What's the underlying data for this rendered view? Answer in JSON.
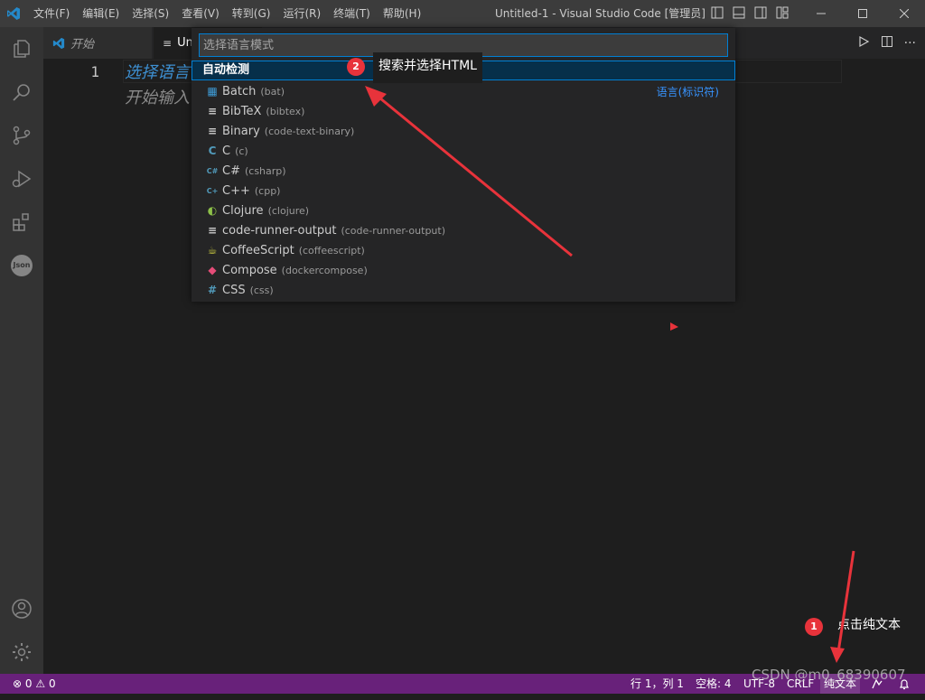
{
  "titlebar": {
    "menus": [
      "文件(F)",
      "编辑(E)",
      "选择(S)",
      "查看(V)",
      "转到(G)",
      "运行(R)",
      "终端(T)",
      "帮助(H)"
    ],
    "title": "Untitled-1 - Visual Studio Code [管理员]"
  },
  "tabs": {
    "start_label": "开始",
    "untitled_label": "Un"
  },
  "editor": {
    "line_number": "1",
    "ghost_line1": "选择语言",
    "ghost_line2": "开始输入"
  },
  "quickpick": {
    "placeholder": "选择语言模式",
    "active_item": "自动检测",
    "separator_label": "语言(标识符)",
    "items": [
      {
        "name": "Batch",
        "id": "(bat)",
        "icon": "windows-icon",
        "color": "#3e9bd6"
      },
      {
        "name": "BibTeX",
        "id": "(bibtex)",
        "icon": "lines-icon",
        "color": "#cccccc"
      },
      {
        "name": "Binary",
        "id": "(code-text-binary)",
        "icon": "lines-icon",
        "color": "#cccccc"
      },
      {
        "name": "C",
        "id": "(c)",
        "icon": "c-icon",
        "color": "#519aba"
      },
      {
        "name": "C#",
        "id": "(csharp)",
        "icon": "csharp-icon",
        "color": "#519aba"
      },
      {
        "name": "C++",
        "id": "(cpp)",
        "icon": "cpp-icon",
        "color": "#519aba"
      },
      {
        "name": "Clojure",
        "id": "(clojure)",
        "icon": "clojure-icon",
        "color": "#8dc149"
      },
      {
        "name": "code-runner-output",
        "id": "(code-runner-output)",
        "icon": "lines-icon",
        "color": "#cccccc"
      },
      {
        "name": "CoffeeScript",
        "id": "(coffeescript)",
        "icon": "coffee-icon",
        "color": "#cbcb41"
      },
      {
        "name": "Compose",
        "id": "(dockercompose)",
        "icon": "docker-icon",
        "color": "#e54c78"
      },
      {
        "name": "CSS",
        "id": "(css)",
        "icon": "hash-icon",
        "color": "#519aba"
      }
    ]
  },
  "annotations": {
    "step1_number": "1",
    "step1_text": "点击纯文本",
    "step2_number": "2",
    "step2_text": "搜索并选择HTML",
    "arrow_color": "#e8333b"
  },
  "statusbar": {
    "errors": "0",
    "warnings": "0",
    "position": "行 1，列 1",
    "spaces": "空格: 4",
    "encoding": "UTF-8",
    "eol": "CRLF",
    "language": "纯文本"
  },
  "watermark": "CSDN @m0_68390607",
  "activitybar": {
    "json_label": "Json"
  }
}
